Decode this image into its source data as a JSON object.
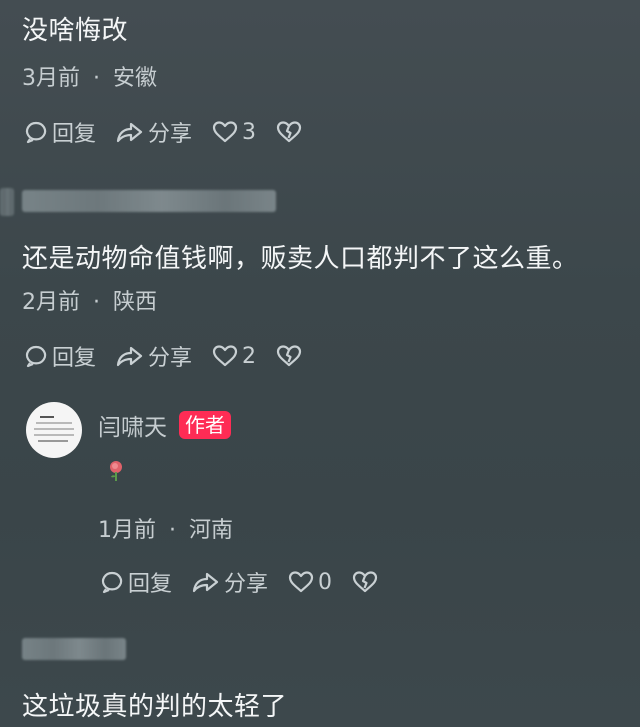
{
  "comments": [
    {
      "text": "没啥悔改",
      "time": "3月前",
      "dot": "·",
      "location": "安徽",
      "reply": "回复",
      "share": "分享",
      "likes": "3"
    },
    {
      "text": "还是动物命值钱啊，贩卖人口都判不了这么重。",
      "time": "2月前",
      "dot": "·",
      "location": "陕西",
      "reply": "回复",
      "share": "分享",
      "likes": "2"
    },
    {
      "text": "这垃圾真的判的太轻了"
    }
  ],
  "author_reply": {
    "username": "闫啸天",
    "badge": "作者",
    "emoji": "rose-icon",
    "time": "1月前",
    "dot": "·",
    "location": "河南",
    "reply": "回复",
    "share": "分享",
    "likes": "0"
  },
  "colors": {
    "background": "#3f4b4f",
    "badge": "#fe2c55",
    "meta_text": "#c6cdd0"
  }
}
